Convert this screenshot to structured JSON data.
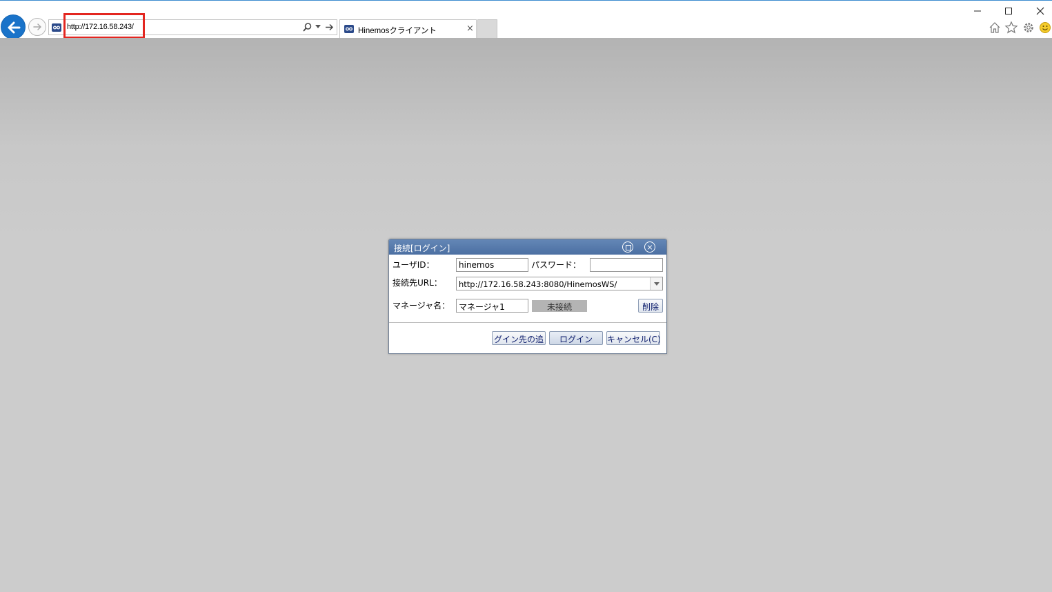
{
  "browser": {
    "url": "http://172.16.58.243/",
    "tab_title": "Hinemosクライアント",
    "tab_close": "×"
  },
  "dialog": {
    "title": "接続[ログイン]",
    "user_id_label": "ユーザID：",
    "user_id_value": "hinemos",
    "password_label": "パスワード：",
    "password_value": "",
    "url_label": "接続先URL：",
    "url_value": "http://172.16.58.243:8080/HinemosWS/",
    "manager_label": "マネージャ名：",
    "manager_value": "マネージャ1",
    "status": "未接続",
    "delete_button": "削除",
    "add_button": "グイン先の追",
    "login_button": "ログイン",
    "cancel_button": "キャンセル(C)"
  },
  "colors": {
    "title_bar": "#5479ad",
    "highlight": "#e32620",
    "back_button": "#1a73c9"
  }
}
